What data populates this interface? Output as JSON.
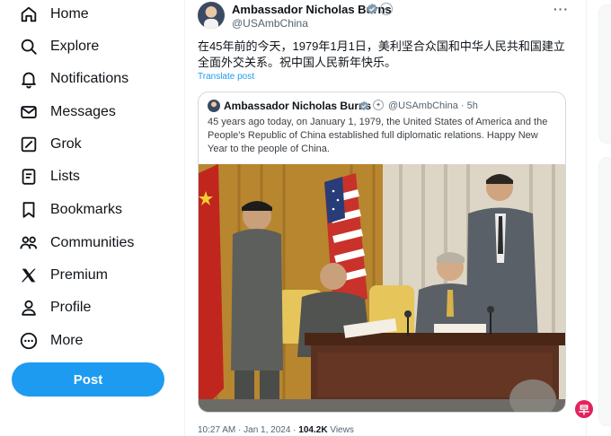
{
  "sidebar": {
    "items": [
      {
        "label": "Home",
        "icon": "home-icon"
      },
      {
        "label": "Explore",
        "icon": "search-icon"
      },
      {
        "label": "Notifications",
        "icon": "bell-icon"
      },
      {
        "label": "Messages",
        "icon": "envelope-icon"
      },
      {
        "label": "Grok",
        "icon": "grok-icon"
      },
      {
        "label": "Lists",
        "icon": "list-icon"
      },
      {
        "label": "Bookmarks",
        "icon": "bookmark-icon"
      },
      {
        "label": "Communities",
        "icon": "people-icon"
      },
      {
        "label": "Premium",
        "icon": "x-logo-icon"
      },
      {
        "label": "Profile",
        "icon": "person-icon"
      },
      {
        "label": "More",
        "icon": "more-circle-icon"
      }
    ],
    "post_label": "Post"
  },
  "tweet": {
    "author_name": "Ambassador Nicholas Burns",
    "handle": "@USAmbChina",
    "text": "在45年前的今天，1979年1月1日，美利坚合众国和中华人民共和国建立全面外交关系。祝中国人民新年快乐。",
    "translate_label": "Translate post",
    "meta_time": "10:27 AM · Jan 1, 2024 · ",
    "meta_views_count": "104.2K",
    "meta_views_label": " Views"
  },
  "quote": {
    "author_name": "Ambassador Nicholas Burns",
    "handle_time": "@USAmbChina · 5h",
    "text": "45 years ago today, on January 1, 1979, the United States of America and the People's Republic of China established full diplomatic relations. Happy New Year to the people of China."
  },
  "watermark": {
    "text": "早"
  },
  "colors": {
    "accent": "#1d9bf0",
    "text": "#0f1419",
    "muted": "#536471"
  }
}
